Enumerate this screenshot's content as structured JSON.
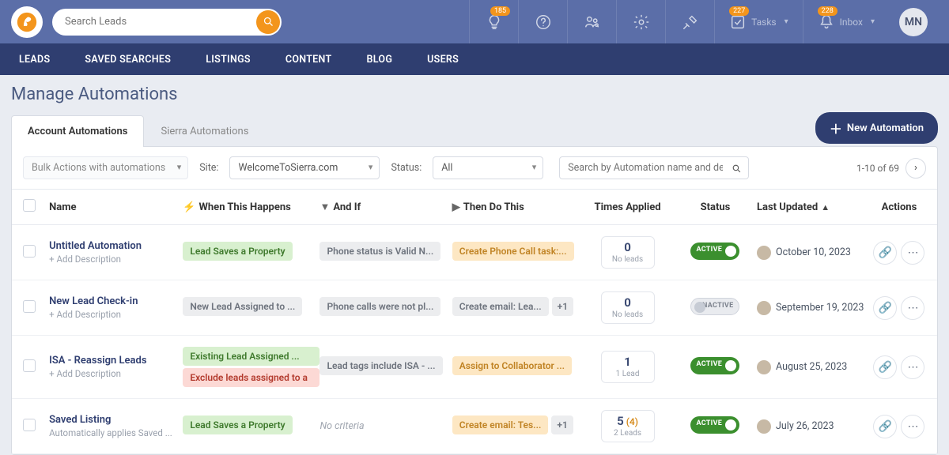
{
  "topbar": {
    "search_placeholder": "Search Leads",
    "tasks_label": "Tasks",
    "tasks_badge": "227",
    "inbox_label": "Inbox",
    "inbox_badge": "228",
    "lightbulb_badge": "185",
    "avatar_initials": "MN"
  },
  "nav": {
    "items": [
      "LEADS",
      "SAVED SEARCHES",
      "LISTINGS",
      "CONTENT",
      "BLOG",
      "USERS"
    ]
  },
  "page": {
    "title": "Manage Automations",
    "tabs": {
      "account": "Account Automations",
      "sierra": "Sierra Automations"
    },
    "new_automation": "New Automation"
  },
  "filters": {
    "bulk_label": "Bulk Actions with automations",
    "site_label": "Site:",
    "site_value": "WelcomeToSierra.com",
    "status_label": "Status:",
    "status_value": "All",
    "search_placeholder": "Search by Automation name and description",
    "pager_text": "1-10 of 69"
  },
  "columns": {
    "name": "Name",
    "when": "When This Happens",
    "andif": "And If",
    "then": "Then Do This",
    "times": "Times Applied",
    "status": "Status",
    "updated": "Last Updated",
    "actions": "Actions"
  },
  "rows": [
    {
      "name": "Untitled Automation",
      "desc": "+ Add Description",
      "when": [
        {
          "text": "Lead Saves a Property",
          "style": "green"
        }
      ],
      "andif": {
        "type": "tag",
        "text": "Phone status is Valid N...",
        "style": "gray"
      },
      "then": {
        "text": "Create Phone Call task:...",
        "style": "yellow",
        "plus": ""
      },
      "times": {
        "n": "0",
        "ext": "",
        "sub": "No leads"
      },
      "status": "on",
      "updated": "October 10, 2023"
    },
    {
      "name": "New Lead Check-in",
      "desc": "+ Add Description",
      "when": [
        {
          "text": "New Lead Assigned to ...",
          "style": "gray"
        }
      ],
      "andif": {
        "type": "tag",
        "text": "Phone calls were not pl...",
        "style": "gray"
      },
      "then": {
        "text": "Create email: Lea...",
        "style": "gray",
        "plus": "+1"
      },
      "times": {
        "n": "0",
        "ext": "",
        "sub": "No leads"
      },
      "status": "off",
      "updated": "September 19, 2023"
    },
    {
      "name": "ISA - Reassign Leads",
      "desc": "+ Add Description",
      "when": [
        {
          "text": "Existing Lead Assigned ...",
          "style": "green2"
        },
        {
          "text": "Exclude leads assigned to a",
          "style": "red"
        }
      ],
      "andif": {
        "type": "tag",
        "text": "Lead tags include ISA - ...",
        "style": "gray"
      },
      "then": {
        "text": "Assign to Collaborator ...",
        "style": "yellow",
        "plus": ""
      },
      "times": {
        "n": "1",
        "ext": "",
        "sub": "1 Lead"
      },
      "status": "on",
      "updated": "August 25, 2023"
    },
    {
      "name": "Saved Listing",
      "desc": "Automatically applies Saved ...",
      "when": [
        {
          "text": "Lead Saves a Property",
          "style": "green"
        }
      ],
      "andif": {
        "type": "none",
        "text": "No criteria"
      },
      "then": {
        "text": "Create email: Tes...",
        "style": "yellow",
        "plus": "+1"
      },
      "times": {
        "n": "5",
        "ext": " (4)",
        "sub": "2 Leads"
      },
      "status": "on",
      "updated": "July 26, 2023"
    }
  ],
  "status_labels": {
    "on": "ACTIVE",
    "off": "INACTIVE"
  }
}
